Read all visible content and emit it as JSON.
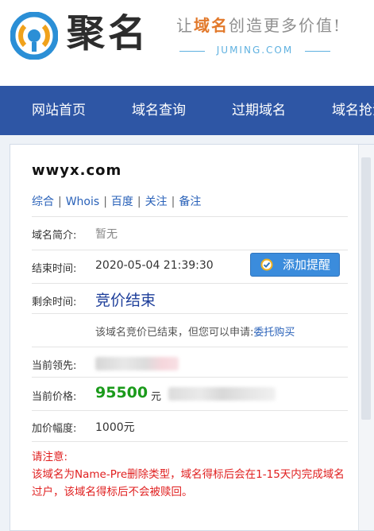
{
  "header": {
    "brand_name": "聚名",
    "slogan_prefix": "让",
    "slogan_highlight": "域名",
    "slogan_suffix": "创造更多价值!",
    "site_url": "JUMING.COM",
    "logo_icon": "juming-logo-icon"
  },
  "nav": {
    "items": [
      {
        "label": "网站首页"
      },
      {
        "label": "域名查询"
      },
      {
        "label": "过期域名"
      },
      {
        "label": "域名抢注"
      }
    ]
  },
  "detail": {
    "domain": "wwyx.com",
    "links": [
      "综合",
      "Whois",
      "百度",
      "关注",
      "备注"
    ],
    "intro_label": "域名简介:",
    "intro_value": "暂无",
    "end_time_label": "结束时间:",
    "end_time_value": "2020-05-04 21:39:30",
    "remind_button": "添加提醒",
    "remind_icon": "check-badge-icon",
    "remain_label": "剩余时间:",
    "remain_value": "竞价结束",
    "ended_note": "该域名竞价已结束，但您可以申请:",
    "entrust_link": "委托购买",
    "leader_label": "当前领先:",
    "price_label": "当前价格:",
    "price_value": "95500",
    "price_unit": "元",
    "increment_label": "加价幅度:",
    "increment_value": "1000元"
  },
  "notice": {
    "title": "请注意:",
    "body": "该域名为Name-Pre删除类型，域名得标后会在1-15天内完成域名过户，该域名得标后不会被赎回。"
  },
  "colors": {
    "nav_bg": "#2e56a5",
    "link": "#2a62b9",
    "price": "#1a9a1a",
    "warning": "#e02020",
    "button": "#3b8cdc",
    "slogan_accent": "#e2792b"
  }
}
